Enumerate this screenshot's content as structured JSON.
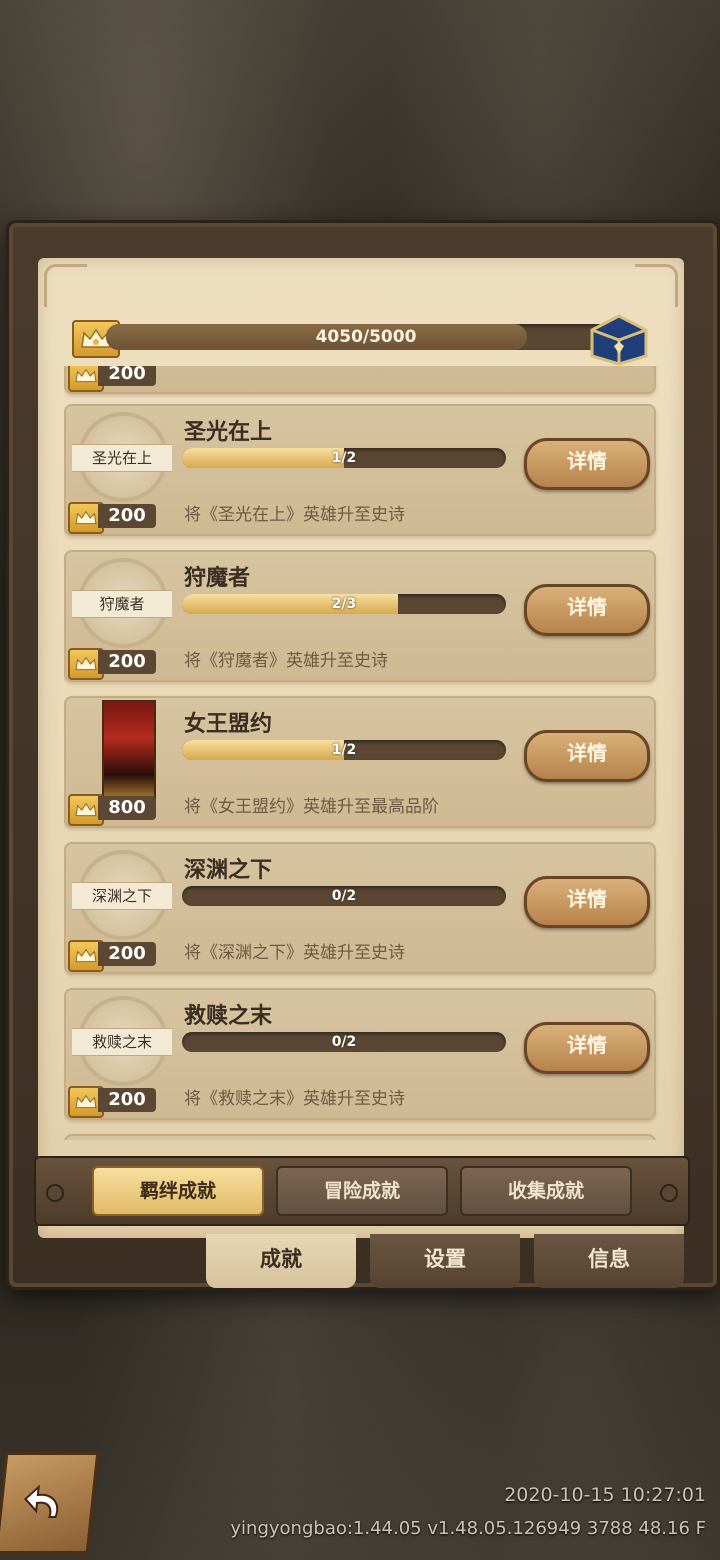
{
  "overall": {
    "progress_text": "4050/5000",
    "progress": 0.81
  },
  "partial_top": {
    "points": "200"
  },
  "achievements": [
    {
      "badge": "圣光在上",
      "title": "圣光在上",
      "progress_text": "1/2",
      "progress": 0.5,
      "points": "200",
      "description": "将《圣光在上》英雄升至史诗",
      "button": "详情",
      "has_portrait": false
    },
    {
      "badge": "狩魔者",
      "title": "狩魔者",
      "progress_text": "2/3",
      "progress": 0.667,
      "points": "200",
      "description": "将《狩魔者》英雄升至史诗",
      "button": "详情",
      "has_portrait": false
    },
    {
      "badge": "",
      "title": "女王盟约",
      "progress_text": "1/2",
      "progress": 0.5,
      "points": "800",
      "description": "将《女王盟约》英雄升至最高品阶",
      "button": "详情",
      "has_portrait": true
    },
    {
      "badge": "深渊之下",
      "title": "深渊之下",
      "progress_text": "0/2",
      "progress": 0,
      "points": "200",
      "description": "将《深渊之下》英雄升至史诗",
      "button": "详情",
      "has_portrait": false
    },
    {
      "badge": "救赎之末",
      "title": "救赎之末",
      "progress_text": "0/2",
      "progress": 0,
      "points": "200",
      "description": "将《救赎之末》英雄升至史诗",
      "button": "详情",
      "has_portrait": false
    }
  ],
  "sub_tabs": [
    {
      "label": "羁绊成就",
      "active": true
    },
    {
      "label": "冒险成就",
      "active": false
    },
    {
      "label": "收集成就",
      "active": false
    }
  ],
  "main_tabs": [
    {
      "label": "成就",
      "active": true
    },
    {
      "label": "设置",
      "active": false
    },
    {
      "label": "信息",
      "active": false
    }
  ],
  "footer": {
    "timestamp": "2020-10-15 10:27:01",
    "version": "yingyongbao:1.44.05  v1.48.05.126949 3788 48.16 F"
  },
  "colors": {
    "gold": "#e2b966",
    "brown": "#5a4632",
    "parchment": "#eadbb9"
  }
}
